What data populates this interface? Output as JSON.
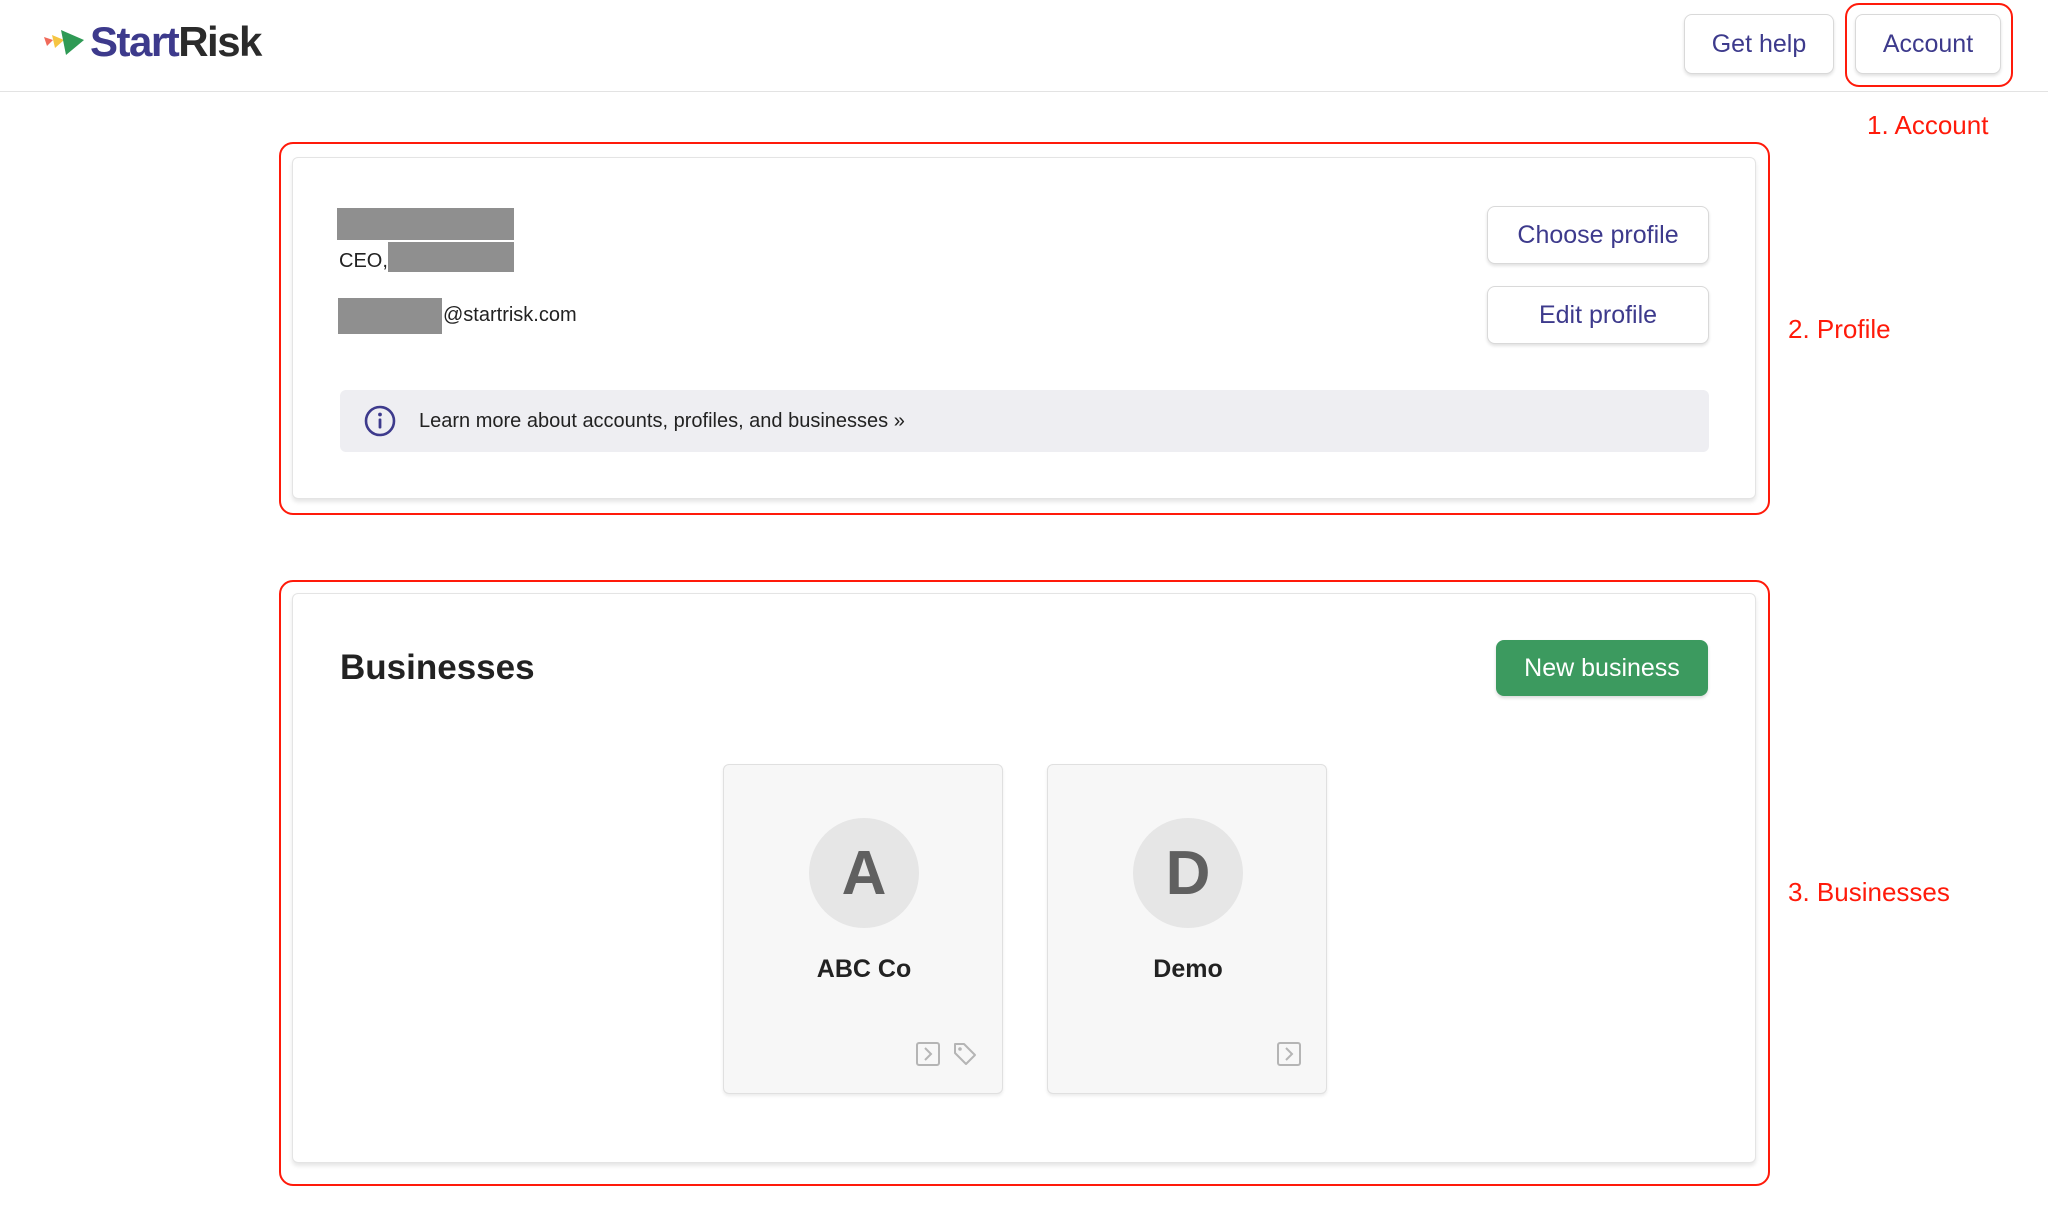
{
  "header": {
    "logo": {
      "part1": "Start",
      "part2": "Risk"
    },
    "help_label": "Get help",
    "account_label": "Account"
  },
  "annotations": {
    "account": "1. Account",
    "profile": "2. Profile",
    "businesses": "3. Businesses"
  },
  "profile": {
    "role_prefix": "CEO,",
    "email_domain": "@startrisk.com",
    "choose_label": "Choose profile",
    "edit_label": "Edit profile",
    "info_text": "Learn more about accounts, profiles, and businesses »"
  },
  "businesses": {
    "title": "Businesses",
    "new_label": "New business",
    "items": [
      {
        "initial": "A",
        "name": "ABC Co"
      },
      {
        "initial": "D",
        "name": "Demo"
      }
    ]
  },
  "colors": {
    "brand": "#3d3a8c",
    "new_button": "#3c9a5f",
    "annotation": "#ff1a0a"
  },
  "icons": [
    "logo-arrows-icon",
    "info-icon",
    "open-arrow-icon",
    "tag-icon"
  ]
}
